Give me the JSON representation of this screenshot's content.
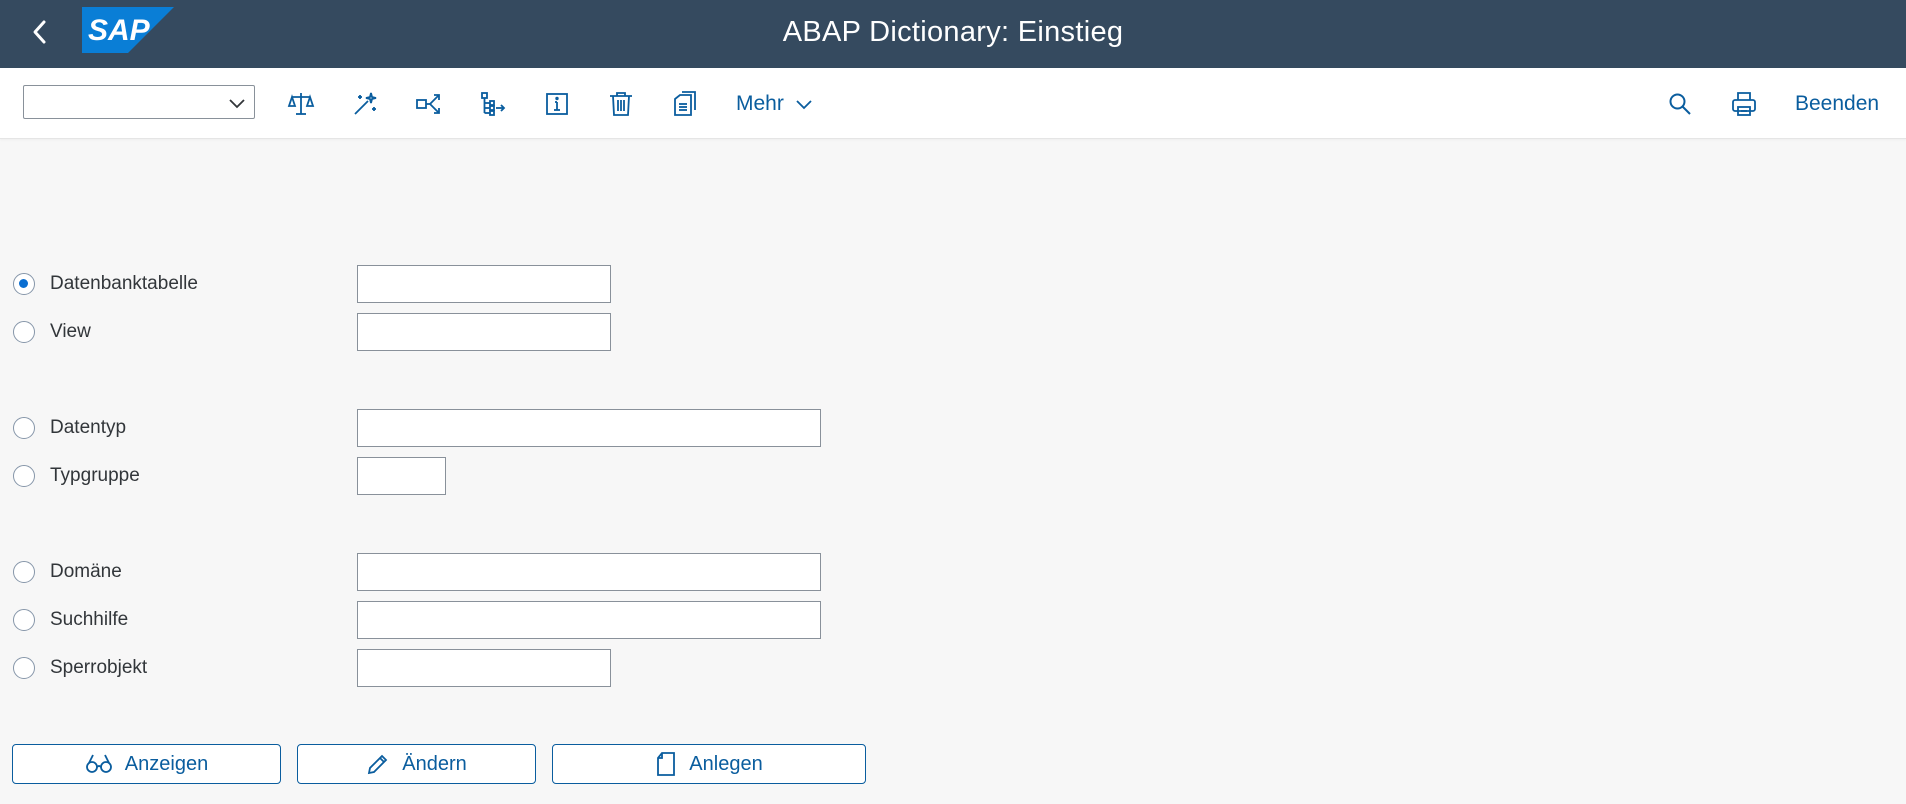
{
  "shell": {
    "title": "ABAP Dictionary: Einstieg",
    "logo_text": "SAP",
    "brand_color": "#354a5f",
    "logo_color": "#0a7ed6"
  },
  "toolbar": {
    "command_field_value": "",
    "icons": [
      "compare-icon",
      "wizard-icon",
      "where-used-icon",
      "hierarchy-icon",
      "info-icon",
      "delete-icon",
      "copy-icon"
    ],
    "more_label": "Mehr",
    "exit_label": "Beenden",
    "accent_color": "#0a5d9e"
  },
  "form": {
    "options": [
      {
        "label": "Datenbanktabelle",
        "selected": true,
        "value": ""
      },
      {
        "label": "View",
        "selected": false,
        "value": ""
      },
      {
        "label": "Datentyp",
        "selected": false,
        "value": ""
      },
      {
        "label": "Typgruppe",
        "selected": false,
        "value": ""
      },
      {
        "label": "Domäne",
        "selected": false,
        "value": ""
      },
      {
        "label": "Suchhilfe",
        "selected": false,
        "value": ""
      },
      {
        "label": "Sperrobjekt",
        "selected": false,
        "value": ""
      }
    ]
  },
  "actions": {
    "display_label": "Anzeigen",
    "change_label": "Ändern",
    "create_label": "Anlegen"
  }
}
